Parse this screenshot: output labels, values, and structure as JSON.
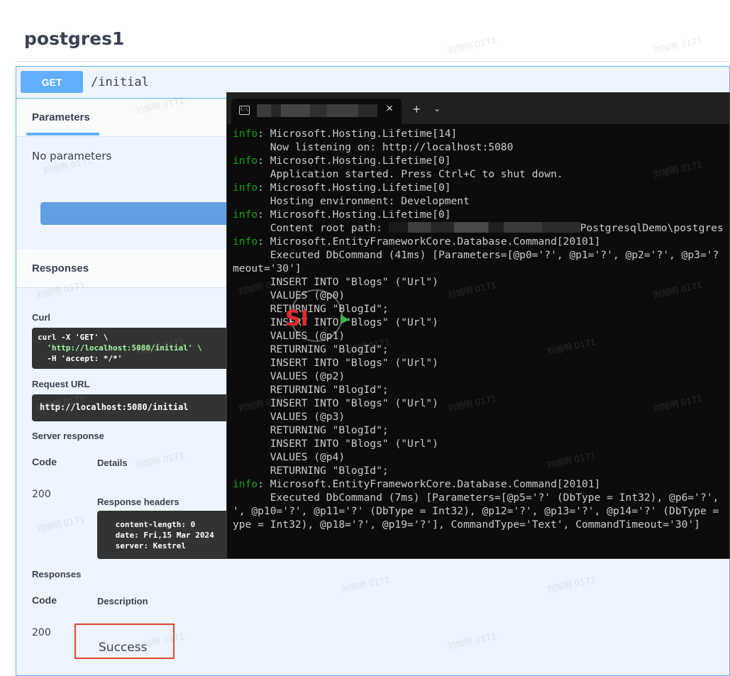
{
  "swagger": {
    "title": "postgres1",
    "method": "GET",
    "path": "/initial",
    "parameters_tab": "Parameters",
    "no_parameters": "No parameters",
    "responses_title": "Responses",
    "curl_label": "Curl",
    "curl_lines": [
      "curl -X 'GET' \\",
      "  'http://localhost:5080/initial' \\",
      "  -H 'accept: */*'"
    ],
    "request_url_label": "Request URL",
    "request_url": "http://localhost:5080/initial",
    "server_response_label": "Server response",
    "code_header": "Code",
    "details_header": "Details",
    "response_code": "200",
    "response_headers_label": "Response headers",
    "response_headers": [
      " content-length: 0",
      " date: Fri,15 Mar 2024 ",
      " server: Kestrel"
    ],
    "responses_label": "Responses",
    "description_header": "Description",
    "doc_code": "200",
    "doc_description": "Success"
  },
  "terminal": {
    "new_tab_symbol": "+",
    "dropdown_symbol": "⌄",
    "close_symbol": "×",
    "tab_icon_text": "C:\\",
    "lines": [
      {
        "level": "info",
        "text": ": Microsoft.Hosting.Lifetime[14]"
      },
      {
        "level": "",
        "text": "      Now listening on: http://localhost:5080"
      },
      {
        "level": "info",
        "text": ": Microsoft.Hosting.Lifetime[0]"
      },
      {
        "level": "",
        "text": "      Application started. Press Ctrl+C to shut down."
      },
      {
        "level": "info",
        "text": ": Microsoft.Hosting.Lifetime[0]"
      },
      {
        "level": "",
        "text": "      Hosting environment: Development"
      },
      {
        "level": "info",
        "text": ": Microsoft.Hosting.Lifetime[0]"
      },
      {
        "level": "",
        "text": "      Content root path: ",
        "redacted": true,
        "after": "PostgresqlDemo\\postgres"
      },
      {
        "level": "info",
        "text": ": Microsoft.EntityFrameworkCore.Database.Command[20101]"
      },
      {
        "level": "",
        "text": "      Executed DbCommand (41ms) [Parameters=[@p0='?', @p1='?', @p2='?', @p3='?"
      },
      {
        "level": "",
        "text": "meout='30']"
      },
      {
        "level": "",
        "text": "      INSERT INTO \"Blogs\" (\"Url\")"
      },
      {
        "level": "",
        "text": "      VALUES (@p0)"
      },
      {
        "level": "",
        "text": "      RETURNING \"BlogId\";"
      },
      {
        "level": "",
        "text": "      INSERT INTO \"Blogs\" (\"Url\")"
      },
      {
        "level": "",
        "text": "      VALUES (@p1)"
      },
      {
        "level": "",
        "text": "      RETURNING \"BlogId\";"
      },
      {
        "level": "",
        "text": "      INSERT INTO \"Blogs\" (\"Url\")"
      },
      {
        "level": "",
        "text": "      VALUES (@p2)"
      },
      {
        "level": "",
        "text": "      RETURNING \"BlogId\";"
      },
      {
        "level": "",
        "text": "      INSERT INTO \"Blogs\" (\"Url\")"
      },
      {
        "level": "",
        "text": "      VALUES (@p3)"
      },
      {
        "level": "",
        "text": "      RETURNING \"BlogId\";"
      },
      {
        "level": "",
        "text": "      INSERT INTO \"Blogs\" (\"Url\")"
      },
      {
        "level": "",
        "text": "      VALUES (@p4)"
      },
      {
        "level": "",
        "text": "      RETURNING \"BlogId\";"
      },
      {
        "level": "info",
        "text": ": Microsoft.EntityFrameworkCore.Database.Command[20101]"
      },
      {
        "level": "",
        "text": "      Executed DbCommand (7ms) [Parameters=[@p5='?' (DbType = Int32), @p6='?',"
      },
      {
        "level": "",
        "text": "', @p10='?', @p11='?' (DbType = Int32), @p12='?', @p13='?', @p14='?' (DbType ="
      },
      {
        "level": "",
        "text": "ype = Int32), @p18='?', @p19='?'], CommandType='Text', CommandTimeout='30']"
      }
    ]
  },
  "watermark": {
    "logo_text": "SI",
    "repeat_text": "刘旭明 0171"
  },
  "colors": {
    "get_blue": "#61affe",
    "log_green": "#13a10e",
    "highlight_red": "#e2462e",
    "terminal_bg": "#0c0c0c"
  }
}
